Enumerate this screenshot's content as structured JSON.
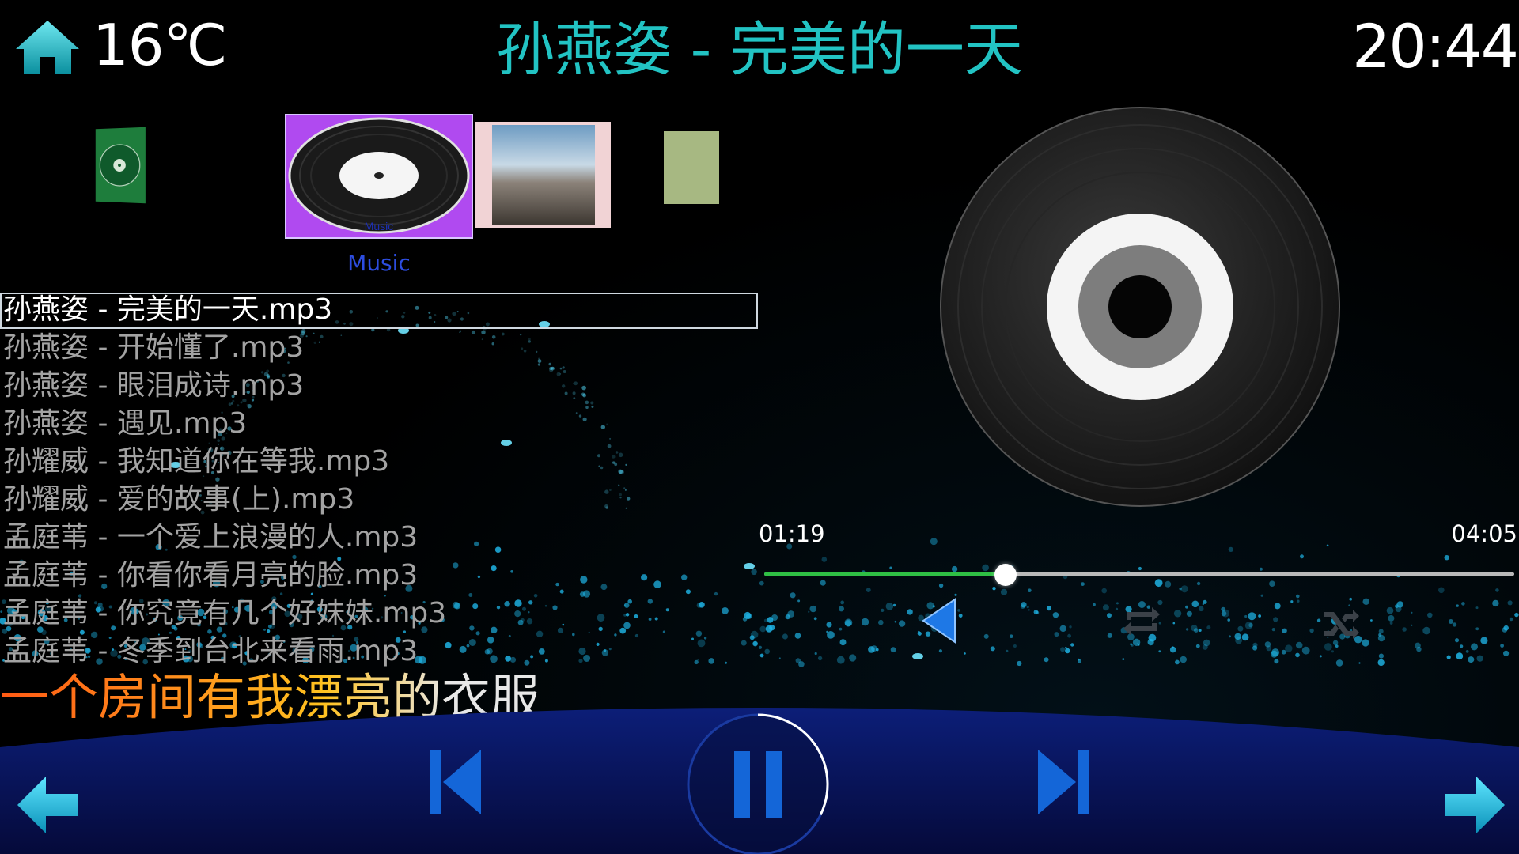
{
  "header": {
    "temperature": "16℃",
    "song_title": "孙燕姿 - 完美的一天",
    "clock": "20:44"
  },
  "carousel": {
    "center_label": "Music",
    "center_disc_text": "Music",
    "covers": [
      "album-cover-left",
      "music-folder-cover",
      "album-cover-right-1",
      "album-cover-right-2"
    ]
  },
  "playlist": {
    "selected_index": 0,
    "tracks": [
      "孙燕姿 - 完美的一天.mp3",
      "孙燕姿 - 开始懂了.mp3",
      "孙燕姿 - 眼泪成诗.mp3",
      "孙燕姿 - 遇见.mp3",
      "孙耀威 - 我知道你在等我.mp3",
      "孙耀威 - 爱的故事(上).mp3",
      "孟庭苇 - 一个爱上浪漫的人.mp3",
      "孟庭苇 - 你看你看月亮的脸.mp3",
      "孟庭苇 - 你究竟有几个好妹妹.mp3",
      "孟庭苇 - 冬季到台北来看雨.mp3"
    ]
  },
  "progress": {
    "current_time": "01:19",
    "total_time": "04:05",
    "fraction": 0.322
  },
  "lyric": {
    "text": "一个房间有我漂亮的衣服"
  },
  "controls": {
    "icons": [
      "home-icon",
      "volume-icon",
      "repeat-icon",
      "shuffle-icon",
      "back-arrow-icon",
      "previous-track-icon",
      "pause-icon",
      "next-track-icon",
      "forward-arrow-icon"
    ]
  },
  "colors": {
    "accent": "#22c3c3",
    "progress": "#2fbf44",
    "control_blue": "#1466d8",
    "bottom_bar": "#0a1a6a",
    "label_blue": "#2d4de0"
  }
}
